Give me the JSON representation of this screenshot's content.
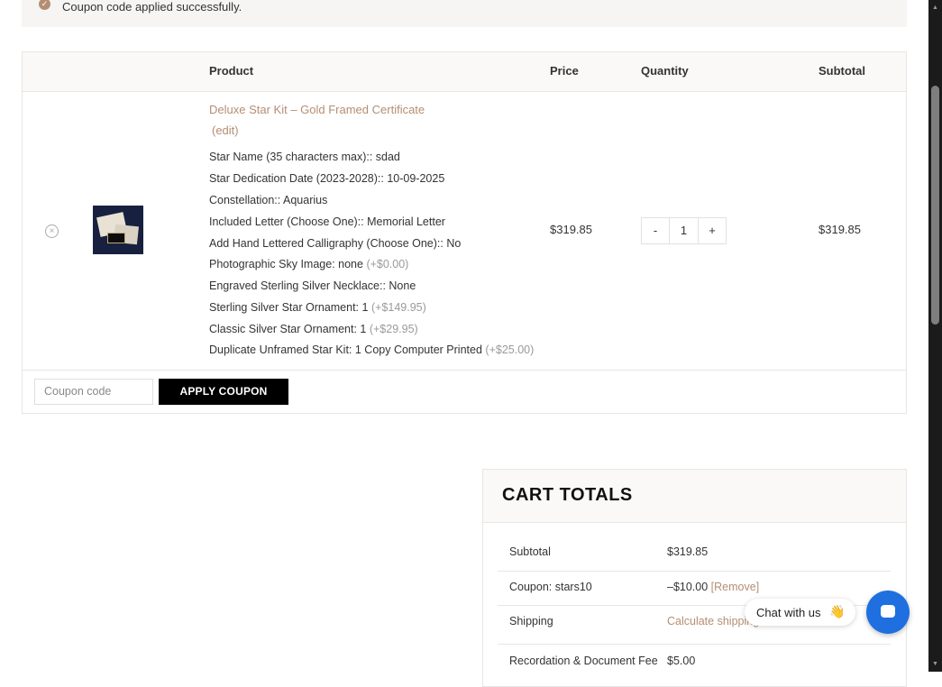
{
  "notice": {
    "message": "Coupon code applied successfully.",
    "icon": "check-circle-icon"
  },
  "cart_table": {
    "headers": {
      "product": "Product",
      "price": "Price",
      "quantity": "Quantity",
      "subtotal": "Subtotal"
    },
    "item": {
      "name": "Deluxe Star Kit – Gold Framed Certificate",
      "edit": "(edit)",
      "meta": [
        {
          "text": "Star Name (35 characters max):: sdad",
          "extra": ""
        },
        {
          "text": "Star Dedication Date (2023-2028):: 10-09-2025",
          "extra": ""
        },
        {
          "text": "Constellation:: Aquarius",
          "extra": ""
        },
        {
          "text": "Included Letter (Choose One):: Memorial Letter",
          "extra": ""
        },
        {
          "text": "Add Hand Lettered Calligraphy (Choose One):: No",
          "extra": ""
        },
        {
          "text": "Photographic Sky Image: none",
          "extra": "(+$0.00)"
        },
        {
          "text": "Engraved Sterling Silver Necklace:: None",
          "extra": ""
        },
        {
          "text": "Sterling Silver Star Ornament: 1",
          "extra": "(+$149.95)"
        },
        {
          "text": "Classic Silver Star Ornament: 1",
          "extra": "(+$29.95)"
        },
        {
          "text": "Duplicate Unframed Star Kit: 1 Copy Computer Printed",
          "extra": "(+$25.00)"
        }
      ],
      "price": "$319.85",
      "quantity": "1",
      "minus": "-",
      "plus": "+",
      "subtotal": "$319.85"
    },
    "coupon_placeholder": "Coupon code",
    "apply_button": "APPLY COUPON"
  },
  "cart_totals": {
    "title": "CART TOTALS",
    "subtotal_label": "Subtotal",
    "subtotal_value": "$319.85",
    "coupon_label": "Coupon: stars10",
    "coupon_value": "–$10.00",
    "coupon_remove": "[Remove]",
    "shipping_label": "Shipping",
    "shipping_value": "Calculate shipping",
    "fee_label": "Recordation & Document Fee",
    "fee_value": "$5.00"
  },
  "chat": {
    "label": "Chat with us",
    "emoji": "👋"
  },
  "colors": {
    "accent": "#b58e72",
    "button": "#000000",
    "chat": "#1f6fe0"
  }
}
